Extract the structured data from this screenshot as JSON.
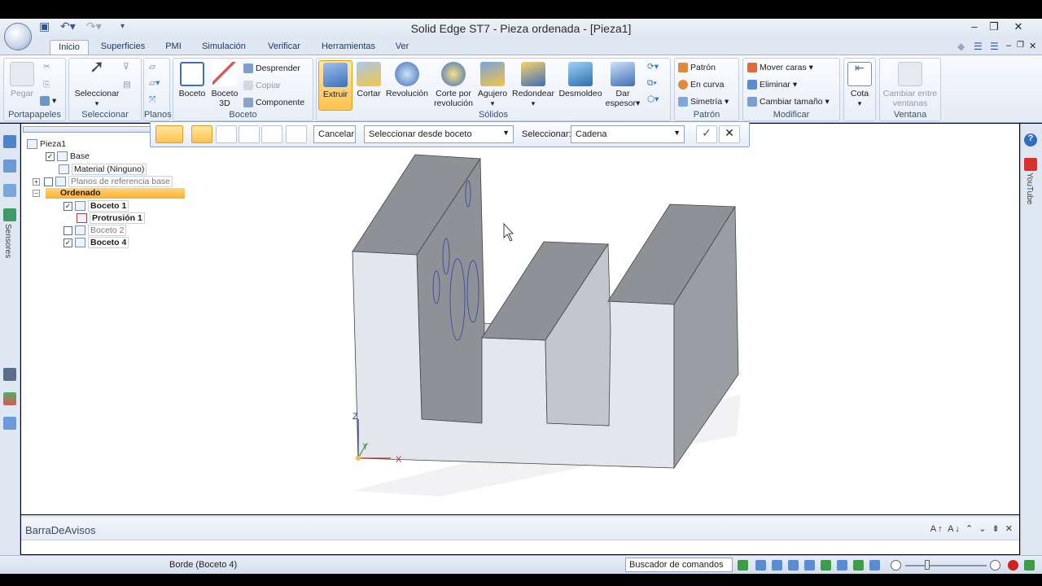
{
  "window": {
    "title": "Solid Edge ST7 - Pieza ordenada - [Pieza1]"
  },
  "tabs": [
    "Inicio",
    "Superficies",
    "PMI",
    "Simulación",
    "Verificar",
    "Herramientas",
    "Ver"
  ],
  "ribbon": {
    "portapapeles": {
      "label": "Portapapeles",
      "pegar": "Pegar"
    },
    "seleccionar": {
      "label": "Seleccionar",
      "btn": "Seleccionar"
    },
    "planos": {
      "label": "Planos"
    },
    "boceto": {
      "label": "Boceto",
      "boceto": "Boceto",
      "boceto3d_1": "Boceto",
      "boceto3d_2": "3D",
      "desprender": "Desprender",
      "copiar": "Copiar",
      "componente": "Componente"
    },
    "solidos": {
      "label": "Sólidos",
      "extruir": "Extruir",
      "cortar": "Cortar",
      "revolucion": "Revolución",
      "corte1": "Corte por",
      "corte2": "revolución",
      "agujero": "Agujero",
      "redondear": "Redondear",
      "desmoldeo": "Desmoldeo",
      "dar1": "Dar",
      "dar2": "espesor"
    },
    "patron": {
      "label": "Patrón",
      "patron": "Patrón",
      "encurva": "En curva",
      "simetria": "Simetría"
    },
    "modificar": {
      "label": "Modificar",
      "mover": "Mover caras",
      "eliminar": "Eliminar",
      "cambiar": "Cambiar tamaño"
    },
    "cota": {
      "label": "Cota"
    },
    "ventana": {
      "label": "Ventana",
      "c1": "Cambiar entre",
      "c2": "ventanas"
    }
  },
  "commandbar": {
    "cancel": "Cancelar",
    "select_from": "Seleccionar desde boceto",
    "select_label": "Seleccionar:",
    "select_value": "Cadena"
  },
  "tree": {
    "root": "Pieza1",
    "base": "Base",
    "material": "Material (Ninguno)",
    "planos": "Planos de referencia base",
    "ordenado": "Ordenado",
    "boceto1": "Boceto 1",
    "protrusion1": "Protrusión 1",
    "boceto2": "Boceto 2",
    "boceto4": "Boceto 4"
  },
  "axes": {
    "z": "Z",
    "y": "Y",
    "x": "X"
  },
  "leftstrip": {
    "sensores": "Sensores"
  },
  "rightstrip": {
    "youtube": "YouTube"
  },
  "notifications": {
    "title": "BarraDeAvisos"
  },
  "status": {
    "text": "Borde (Boceto 4)",
    "finder": "Buscador de comandos"
  },
  "colors": {
    "ribbon": "#e3ebf6",
    "highlight": "#ffc24d",
    "face_light": "#e3e6ec",
    "face_mid": "#c3c6cc",
    "face_dark": "#8e9196"
  }
}
